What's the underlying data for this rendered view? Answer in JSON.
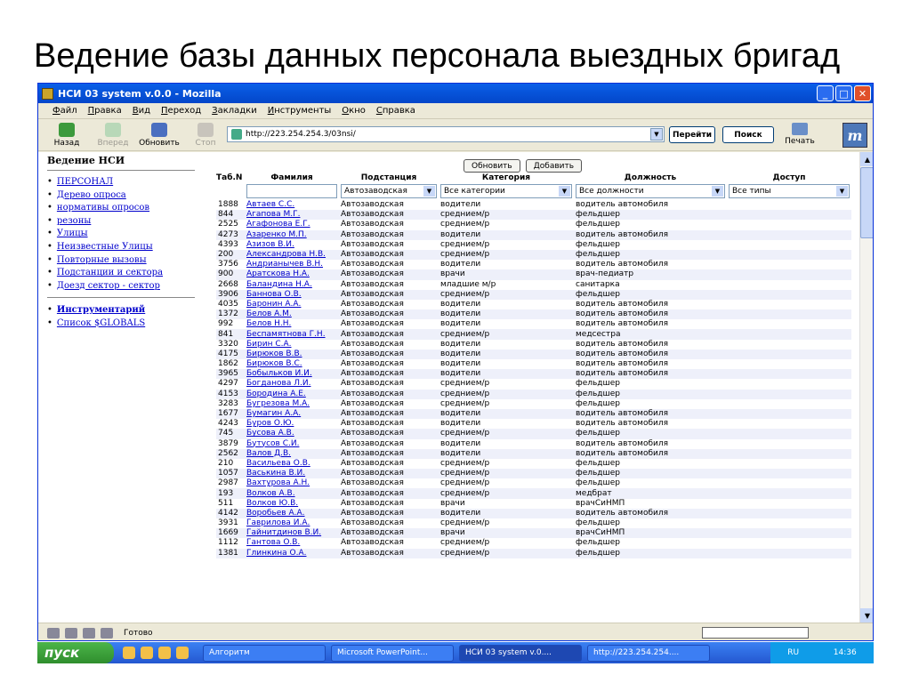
{
  "slide_title": "Ведение базы данных персонала выездных бригад",
  "window": {
    "title": "НСИ 03 system v.0.0 - Mozilla"
  },
  "menu": [
    "Файл",
    "Правка",
    "Вид",
    "Переход",
    "Закладки",
    "Инструменты",
    "Окно",
    "Справка"
  ],
  "toolbar": {
    "back": "Назад",
    "forward": "Вперед",
    "reload": "Обновить",
    "stop": "Стоп",
    "url": "http://223.254.254.3/03nsi/",
    "go": "Перейти",
    "search": "Поиск",
    "print": "Печать"
  },
  "sidebar": {
    "title": "Ведение НСИ",
    "links": [
      "ПЕРСОНАЛ",
      "Дерево опроса",
      "нормативы опросов",
      "резоны",
      "Улицы",
      "Неизвестные Улицы",
      "Повторные вызовы",
      "Подстанции и сектора",
      "Доезд сектор - сектор"
    ],
    "tools": [
      "Инструментарий",
      "Список $GLOBALS"
    ]
  },
  "main": {
    "refresh_button": "Обновить",
    "add_button": "Добавить",
    "columns": [
      "Таб.N",
      "Фамилия",
      "Подстанция",
      "Категория",
      "Должность",
      "Доступ"
    ],
    "filters": {
      "substation": "Автозаводская",
      "category": "Все категории",
      "position": "Все должности",
      "access": "Все типы"
    },
    "rows": [
      [
        "1888",
        "Автаев С.С.",
        "Автозаводская",
        "водители",
        "водитель автомобиля"
      ],
      [
        "844",
        "Агапова М.Г.",
        "Автозаводская",
        "среднием/р",
        "фельдшер"
      ],
      [
        "2525",
        "Агафонова Е.Г.",
        "Автозаводская",
        "среднием/р",
        "фельдшер"
      ],
      [
        "4273",
        "Азаренко М.П.",
        "Автозаводская",
        "водители",
        "водитель автомобиля"
      ],
      [
        "4393",
        "Азизов В.И.",
        "Автозаводская",
        "среднием/р",
        "фельдшер"
      ],
      [
        "200",
        "Александрова Н.В.",
        "Автозаводская",
        "среднием/р",
        "фельдшер"
      ],
      [
        "3756",
        "Андрианычев В.Н.",
        "Автозаводская",
        "водители",
        "водитель автомобиля"
      ],
      [
        "900",
        "Аратскова Н.А.",
        "Автозаводская",
        "врачи",
        "врач-педиатр"
      ],
      [
        "2668",
        "Баландина Н.А.",
        "Автозаводская",
        "младшие м/р",
        "санитарка"
      ],
      [
        "3906",
        "Баннова О.В.",
        "Автозаводская",
        "среднием/р",
        "фельдшер"
      ],
      [
        "4035",
        "Баронин А.А.",
        "Автозаводская",
        "водители",
        "водитель автомобиля"
      ],
      [
        "1372",
        "Белов А.М.",
        "Автозаводская",
        "водители",
        "водитель автомобиля"
      ],
      [
        "992",
        "Белов Н.Н.",
        "Автозаводская",
        "водители",
        "водитель автомобиля"
      ],
      [
        "841",
        "Беспамятнова Г.Н.",
        "Автозаводская",
        "среднием/р",
        "медсестра"
      ],
      [
        "3320",
        "Бирин С.А.",
        "Автозаводская",
        "водители",
        "водитель автомобиля"
      ],
      [
        "4175",
        "Бирюков В.В.",
        "Автозаводская",
        "водители",
        "водитель автомобиля"
      ],
      [
        "1862",
        "Бирюков В.С.",
        "Автозаводская",
        "водители",
        "водитель автомобиля"
      ],
      [
        "3965",
        "Бобыльков И.И.",
        "Автозаводская",
        "водители",
        "водитель автомобиля"
      ],
      [
        "4297",
        "Богданова Л.И.",
        "Автозаводская",
        "среднием/р",
        "фельдшер"
      ],
      [
        "4153",
        "Бородина А.Е.",
        "Автозаводская",
        "среднием/р",
        "фельдшер"
      ],
      [
        "3283",
        "Бугрезова М.А.",
        "Автозаводская",
        "среднием/р",
        "фельдшер"
      ],
      [
        "1677",
        "Бумагин А.А.",
        "Автозаводская",
        "водители",
        "водитель автомобиля"
      ],
      [
        "4243",
        "Буров О.Ю.",
        "Автозаводская",
        "водители",
        "водитель автомобиля"
      ],
      [
        "745",
        "Бусова А.В.",
        "Автозаводская",
        "среднием/р",
        "фельдшер"
      ],
      [
        "3879",
        "Бутусов С.И.",
        "Автозаводская",
        "водители",
        "водитель автомобиля"
      ],
      [
        "2562",
        "Валов Д.В.",
        "Автозаводская",
        "водители",
        "водитель автомобиля"
      ],
      [
        "210",
        "Васильева О.В.",
        "Автозаводская",
        "среднием/р",
        "фельдшер"
      ],
      [
        "1057",
        "Васькина В.И.",
        "Автозаводская",
        "среднием/р",
        "фельдшер"
      ],
      [
        "2987",
        "Вахтурова А.Н.",
        "Автозаводская",
        "среднием/р",
        "фельдшер"
      ],
      [
        "193",
        "Волков А.В.",
        "Автозаводская",
        "среднием/р",
        "медбрат"
      ],
      [
        "511",
        "Волков Ю.В.",
        "Автозаводская",
        "врачи",
        "врачСиНМП"
      ],
      [
        "4142",
        "Воробьев А.А.",
        "Автозаводская",
        "водители",
        "водитель автомобиля"
      ],
      [
        "3931",
        "Гаврилова И.А.",
        "Автозаводская",
        "среднием/р",
        "фельдшер"
      ],
      [
        "1669",
        "Гайнитдинов В.И.",
        "Автозаводская",
        "врачи",
        "врачСиНМП"
      ],
      [
        "1112",
        "Гантова О.В.",
        "Автозаводская",
        "среднием/р",
        "фельдшер"
      ],
      [
        "1381",
        "Глинкина О.А.",
        "Автозаводская",
        "среднием/р",
        "фельдшер"
      ]
    ]
  },
  "status": {
    "text": "Готово"
  },
  "taskbar": {
    "start": "пуск",
    "tasks": [
      "Алгоритм",
      "Microsoft PowerPoint...",
      "НСИ 03 system v.0....",
      "http://223.254.254...."
    ],
    "lang": "RU",
    "clock": "14:36"
  }
}
